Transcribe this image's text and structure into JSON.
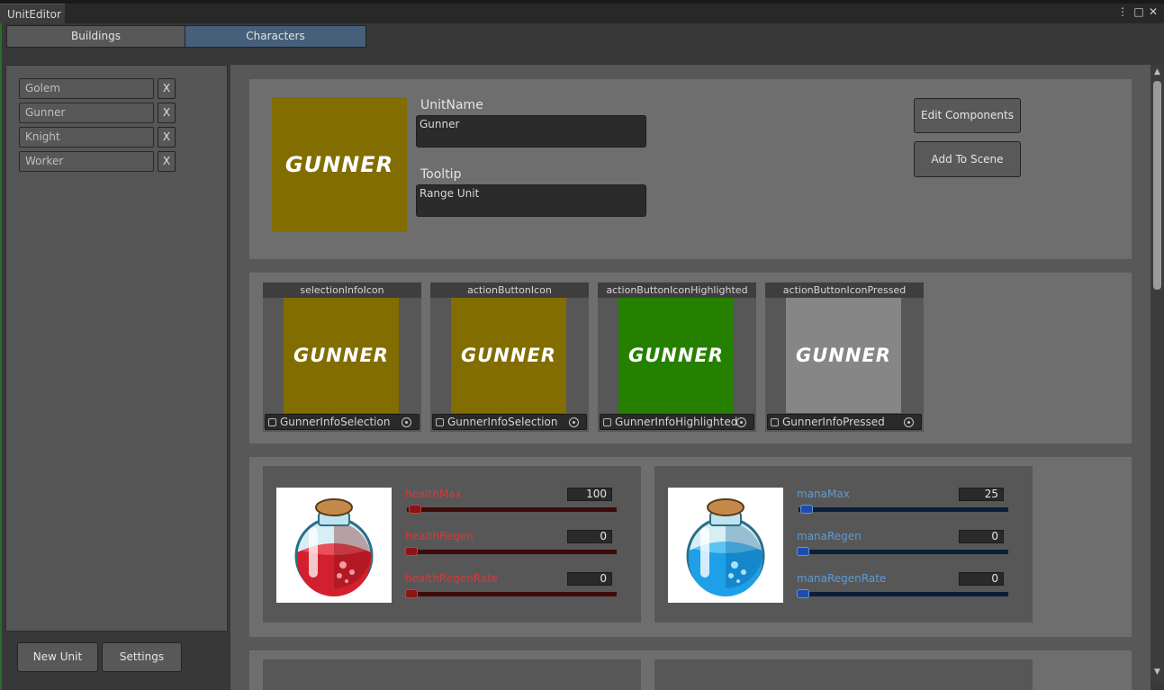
{
  "window": {
    "title": "UnitEditor",
    "more_icon": "⋮",
    "maximize_icon": "□",
    "close_icon": "✕"
  },
  "tabs": [
    {
      "label": "Buildings",
      "active": false
    },
    {
      "label": "Characters",
      "active": true
    }
  ],
  "unit_list": [
    {
      "name": "Golem",
      "delete_label": "X"
    },
    {
      "name": "Gunner",
      "delete_label": "X"
    },
    {
      "name": "Knight",
      "delete_label": "X"
    },
    {
      "name": "Worker",
      "delete_label": "X"
    }
  ],
  "footer": {
    "new_unit_label": "New Unit",
    "settings_label": "Settings"
  },
  "detail": {
    "portrait_text": "GUNNER",
    "portrait_color": "#826d00",
    "unit_name_label": "UnitName",
    "unit_name_value": "Gunner",
    "tooltip_label": "Tooltip",
    "tooltip_value": "Range Unit",
    "edit_components_label": "Edit Components",
    "add_to_scene_label": "Add To Scene"
  },
  "icon_slots": [
    {
      "header": "selectionInfoIcon",
      "image_text": "GUNNER",
      "color": "#826d00",
      "asset": "GunnerInfoSelection"
    },
    {
      "header": "actionButtonIcon",
      "image_text": "GUNNER",
      "color": "#826d00",
      "asset": "GunnerInfoSelection"
    },
    {
      "header": "actionButtonIconHighlighted",
      "image_text": "GUNNER",
      "color": "#268000",
      "asset": "GunnerInfoHighlighted"
    },
    {
      "header": "actionButtonIconPressed",
      "image_text": "GUNNER",
      "color": "#868686",
      "asset": "GunnerInfoPressed"
    }
  ],
  "stats": {
    "health": {
      "icon": "red-potion-icon",
      "label_color": "#d43a3a",
      "track_color": "#3f0a0a",
      "knob_color": "#8b1414",
      "fields": [
        {
          "label": "healthMax",
          "value": "100",
          "fraction": 0.02
        },
        {
          "label": "healthRegen",
          "value": "0",
          "fraction": 0
        },
        {
          "label": "healthRegenRate",
          "value": "0",
          "fraction": 0
        }
      ]
    },
    "mana": {
      "icon": "blue-potion-icon",
      "label_color": "#5b9bd6",
      "track_color": "#0b1e3a",
      "knob_color": "#1f4bb0",
      "fields": [
        {
          "label": "manaMax",
          "value": "25",
          "fraction": 0.02
        },
        {
          "label": "manaRegen",
          "value": "0",
          "fraction": 0
        },
        {
          "label": "manaRegenRate",
          "value": "0",
          "fraction": 0
        }
      ]
    }
  }
}
